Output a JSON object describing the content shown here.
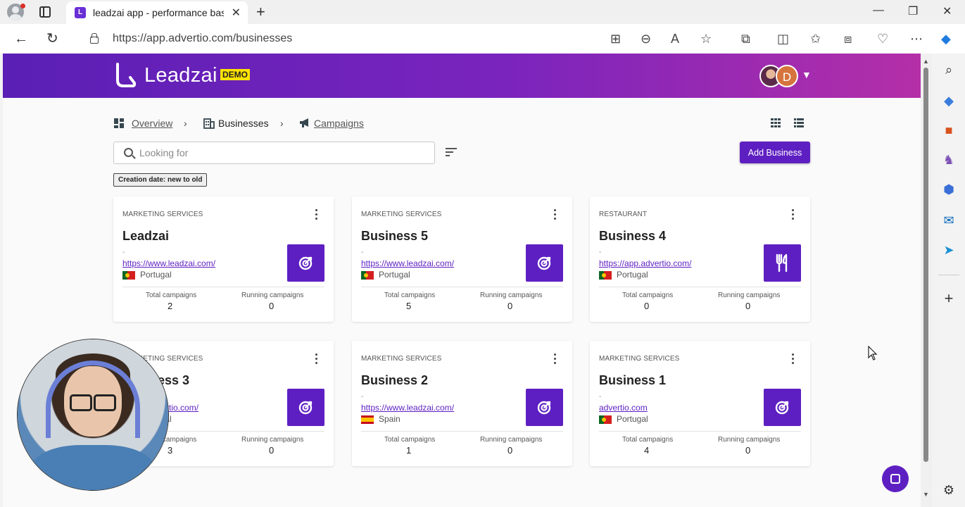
{
  "browser": {
    "tab_title": "leadzai app - performance based",
    "tab_favicon": "L",
    "url": "https://app.advertio.com/businesses"
  },
  "app": {
    "logo_text": "Leadzai",
    "demo_badge": "DEMO",
    "avatar_letter": "D",
    "breadcrumb": {
      "overview": "Overview",
      "businesses": "Businesses",
      "campaigns": "Campaigns"
    },
    "search": {
      "placeholder": "Looking for",
      "value": ""
    },
    "add_button": "Add Business",
    "sort_chip": "Creation date: new to old",
    "stat_labels": {
      "total": "Total campaigns",
      "running": "Running campaigns"
    },
    "cards": [
      {
        "category": "MARKETING SERVICES",
        "name": "Leadzai",
        "dash": "-",
        "url": "https://www.leadzai.com/",
        "country": "Portugal",
        "flag": "pt",
        "icon": "target-icon",
        "total": "2",
        "running": "0"
      },
      {
        "category": "MARKETING SERVICES",
        "name": "Business 5",
        "dash": "-",
        "url": "https://www.leadzai.com/",
        "country": "Portugal",
        "flag": "pt",
        "icon": "target-icon",
        "total": "5",
        "running": "0"
      },
      {
        "category": "RESTAURANT",
        "name": "Business 4",
        "dash": "-",
        "url": "https://app.advertio.com/",
        "country": "Portugal",
        "flag": "pt",
        "icon": "fork-knife-icon",
        "total": "0",
        "running": "0"
      },
      {
        "category": "MARKETING SERVICES",
        "name": "Business 3",
        "dash": "-",
        "url": "https://advertio.com/",
        "country": "Portugal",
        "flag": "pt",
        "icon": "target-icon",
        "total": "3",
        "running": "0"
      },
      {
        "category": "MARKETING SERVICES",
        "name": "Business 2",
        "dash": "-",
        "url": "https://www.leadzai.com/",
        "country": "Spain",
        "flag": "es",
        "icon": "target-icon",
        "total": "1",
        "running": "0"
      },
      {
        "category": "MARKETING SERVICES",
        "name": "Business 1",
        "dash": "-",
        "url": "advertio.com",
        "country": "Portugal",
        "flag": "pt",
        "icon": "target-icon",
        "total": "4",
        "running": "0"
      }
    ]
  },
  "colors": {
    "accent": "#5e1fc2",
    "header_start": "#5a1fb5",
    "header_end": "#b42fa8",
    "demo_badge": "#ffe300"
  }
}
